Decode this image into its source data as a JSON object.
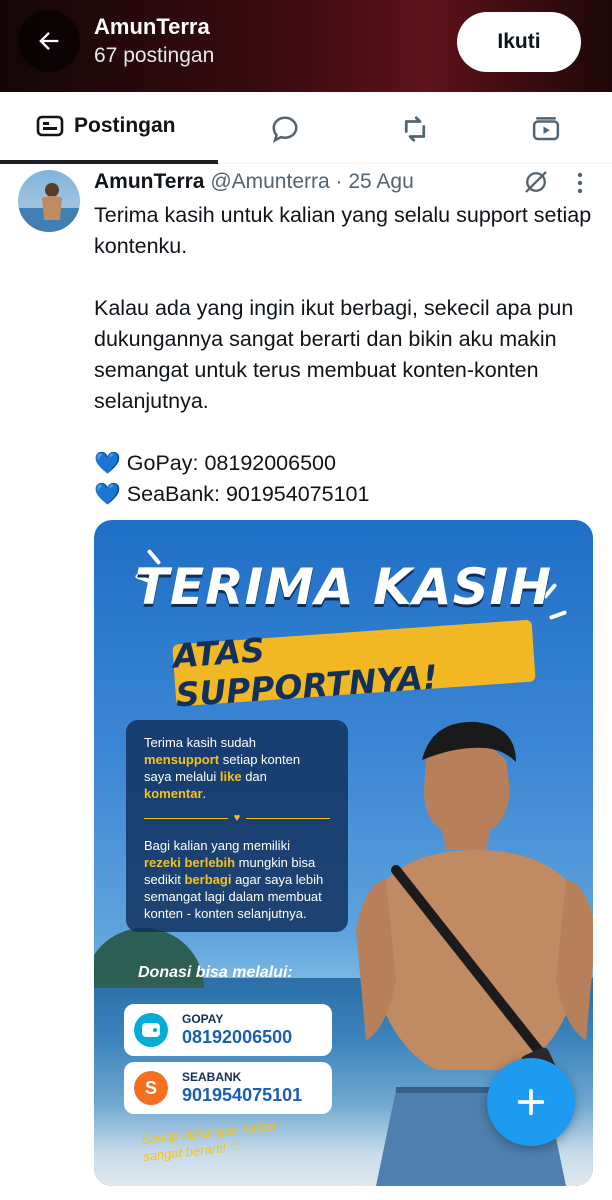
{
  "header": {
    "name": "AmunTerra",
    "post_count": "67 postingan",
    "follow_label": "Ikuti",
    "background_color": "#3a0b10"
  },
  "tabs": {
    "active_label": "Postingan",
    "items": [
      {
        "name": "posts-tab",
        "icon": "timeline-icon",
        "label": "Postingan"
      },
      {
        "name": "replies-tab",
        "icon": "reply-bubble-icon"
      },
      {
        "name": "reposts-tab",
        "icon": "repost-icon"
      },
      {
        "name": "media-tab",
        "icon": "video-icon"
      }
    ]
  },
  "post": {
    "author_name": "AmunTerra",
    "handle": "@Amunterra",
    "separator": "·",
    "date": "25 Agu",
    "paragraph1": "Terima kasih untuk kalian yang selalu support setiap kontenku.",
    "paragraph2": "Kalau ada yang ingin ikut berbagi, sekecil apa pun dukungannya sangat berarti dan bikin aku makin semangat untuk terus membuat konten-konten selanjutnya.",
    "payment1": "GoPay: 08192006500",
    "payment2": "SeaBank: 901954075101",
    "heart_emoji": "💙"
  },
  "media": {
    "title_line1": "TERIMA KASIH",
    "title_line2": "ATAS SUPPORTNYA!",
    "info_p1_a": "Terima kasih sudah",
    "info_p1_hl1": "mensupport",
    "info_p1_b": "setiap konten saya melalui",
    "info_p1_hl2": "like",
    "info_p1_c": "dan",
    "info_p1_hl3": "komentar",
    "info_p1_d": ".",
    "info_p2_a": "Bagi kalian yang memiliki",
    "info_p2_hl1": "rezeki berlebih",
    "info_p2_b": "mungkin bisa sedikit",
    "info_p2_hl2": "berbagi",
    "info_p2_c": "agar saya lebih semangat lagi dalam membuat konten - konten selanjutnya.",
    "donasi_label": "Donasi bisa melalui:",
    "gopay_name": "GOPAY",
    "gopay_number": "08192006500",
    "seabank_name": "SEABANK",
    "seabank_number": "901954075101",
    "footer_line1": "Setiap dukungan kalian",
    "footer_line2": "sangat berarti!",
    "accent_color": "#f2b823"
  },
  "fab": {
    "icon": "plus-icon",
    "color": "#1d9bf0"
  }
}
